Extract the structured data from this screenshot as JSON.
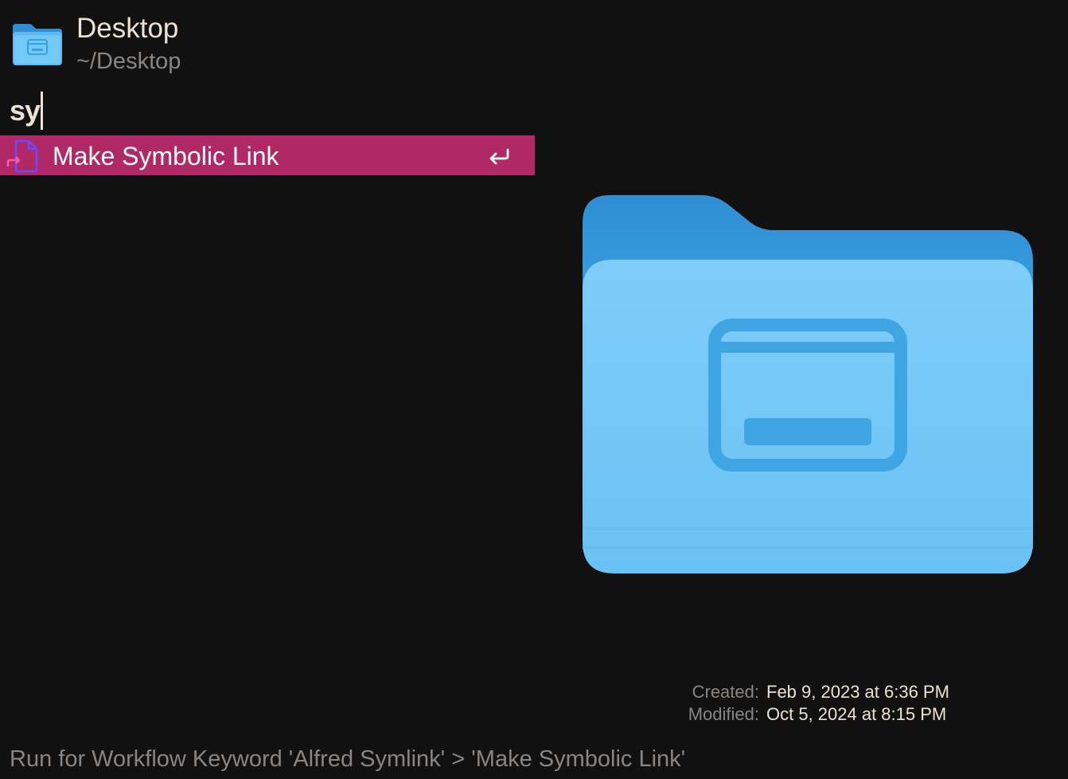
{
  "header": {
    "icon": "folder-icon",
    "title": "Desktop",
    "path": "~/Desktop"
  },
  "query": {
    "text": "sy"
  },
  "results": [
    {
      "icon": "symlink-file-icon",
      "label": "Make Symbolic Link",
      "shortcut_icon": "return-key-icon",
      "selected": true
    }
  ],
  "preview": {
    "icon": "desktop-folder-icon"
  },
  "metadata": {
    "created_label": "Created:",
    "created_value": "Feb 9, 2023 at 6:36 PM",
    "modified_label": "Modified:",
    "modified_value": "Oct 5, 2024 at 8:15 PM"
  },
  "footer": {
    "text": "Run for Workflow Keyword 'Alfred Symlink' > 'Make Symbolic Link'"
  },
  "colors": {
    "background": "#121111",
    "selection": "#b02866",
    "primary_text": "#ece2d3",
    "secondary_text": "#8a8580",
    "folder_blue": "#6cc4f5"
  }
}
